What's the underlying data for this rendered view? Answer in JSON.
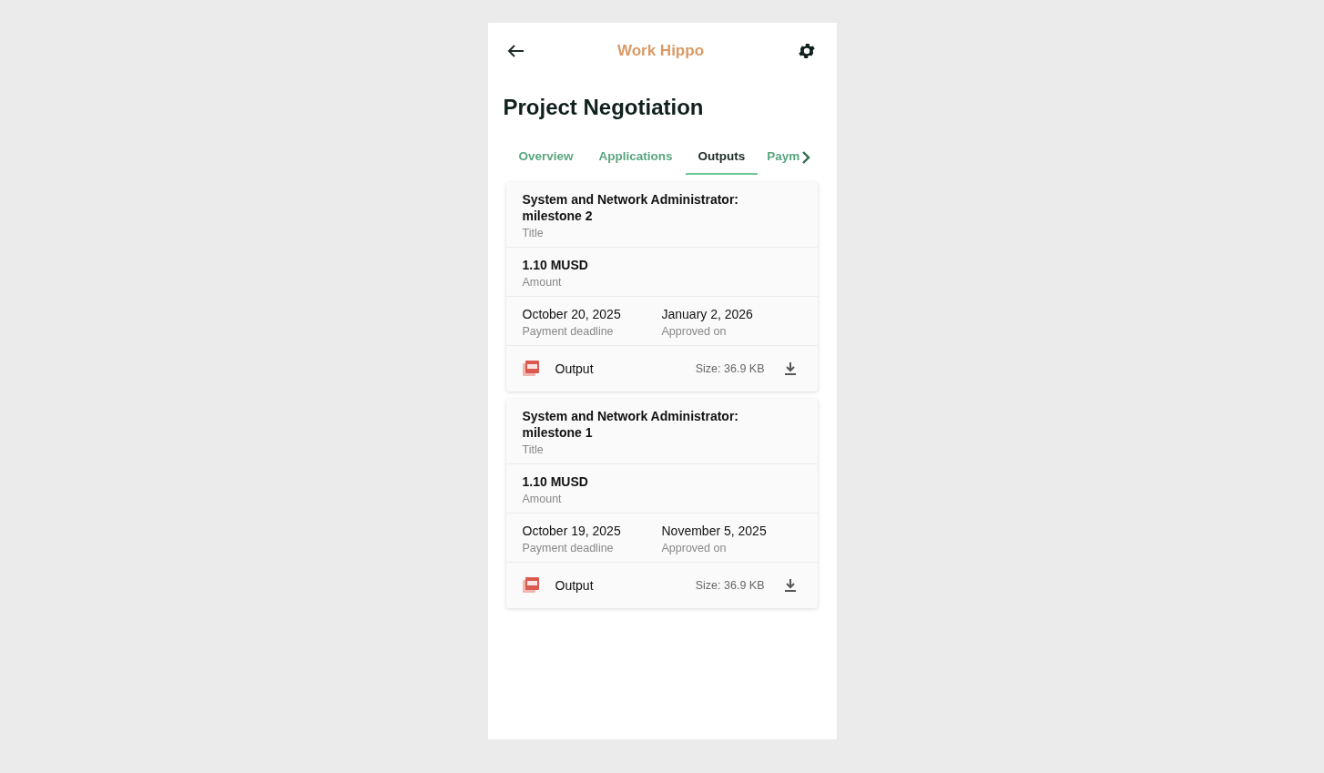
{
  "app_bar": {
    "title": "Work Hippo"
  },
  "page": {
    "title": "Project Negotiation"
  },
  "tabs": [
    {
      "label": "Overview",
      "selected": false
    },
    {
      "label": "Applications",
      "selected": false
    },
    {
      "label": "Outputs",
      "selected": true
    },
    {
      "label": "Paym",
      "selected": false
    }
  ],
  "outputs": [
    {
      "title": "System and Network Administrator: milestone 2",
      "title_label": "Title",
      "amount": "1.10 MUSD",
      "amount_label": "Amount",
      "deadline": "October 20, 2025",
      "deadline_label": "Payment deadline",
      "approved": "January 2, 2026",
      "approved_label": "Approved on",
      "file": "Output",
      "size": "Size: 36.9 KB"
    },
    {
      "title": "System and Network Administrator: milestone 1",
      "title_label": "Title",
      "amount": "1.10 MUSD",
      "amount_label": "Amount",
      "deadline": "October 19, 2025",
      "deadline_label": "Payment deadline",
      "approved": "November 5, 2025",
      "approved_label": "Approved on",
      "file": "Output",
      "size": "Size: 36.9 KB"
    }
  ]
}
